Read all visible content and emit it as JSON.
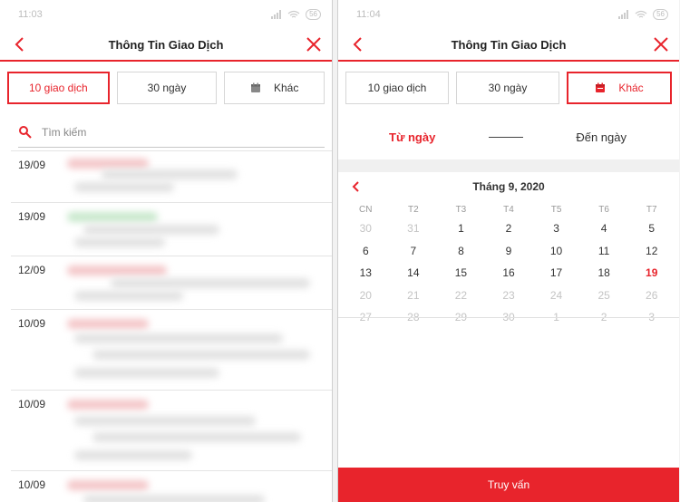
{
  "left": {
    "status_time": "11:03",
    "battery": "56",
    "title": "Thông Tin Giao Dịch",
    "filters": [
      "10 giao dịch",
      "30 ngày",
      "Khác"
    ],
    "search_placeholder": "Tìm kiếm",
    "transactions": [
      {
        "date": "19/09"
      },
      {
        "date": "19/09"
      },
      {
        "date": "12/09"
      },
      {
        "date": "10/09"
      },
      {
        "date": "10/09"
      },
      {
        "date": "10/09"
      }
    ]
  },
  "right": {
    "status_time": "11:04",
    "battery": "56",
    "title": "Thông Tin Giao Dịch",
    "filters": [
      "10 giao dịch",
      "30 ngày",
      "Khác"
    ],
    "from_label": "Từ ngày",
    "to_label": "Đến ngày",
    "month_label": "Tháng 9, 2020",
    "weekdays": [
      "CN",
      "T2",
      "T3",
      "T4",
      "T5",
      "T6",
      "T7"
    ],
    "weeks": [
      [
        "30",
        "31",
        "1",
        "2",
        "3",
        "4",
        "5"
      ],
      [
        "6",
        "7",
        "8",
        "9",
        "10",
        "11",
        "12"
      ],
      [
        "13",
        "14",
        "15",
        "16",
        "17",
        "18",
        "19"
      ],
      [
        "20",
        "21",
        "22",
        "23",
        "24",
        "25",
        "26"
      ],
      [
        "27",
        "28",
        "29",
        "30",
        "1",
        "2",
        "3"
      ]
    ],
    "submit_label": "Truy vấn"
  },
  "colors": {
    "accent": "#e8242c",
    "muted_day": "#c4c4c4"
  }
}
